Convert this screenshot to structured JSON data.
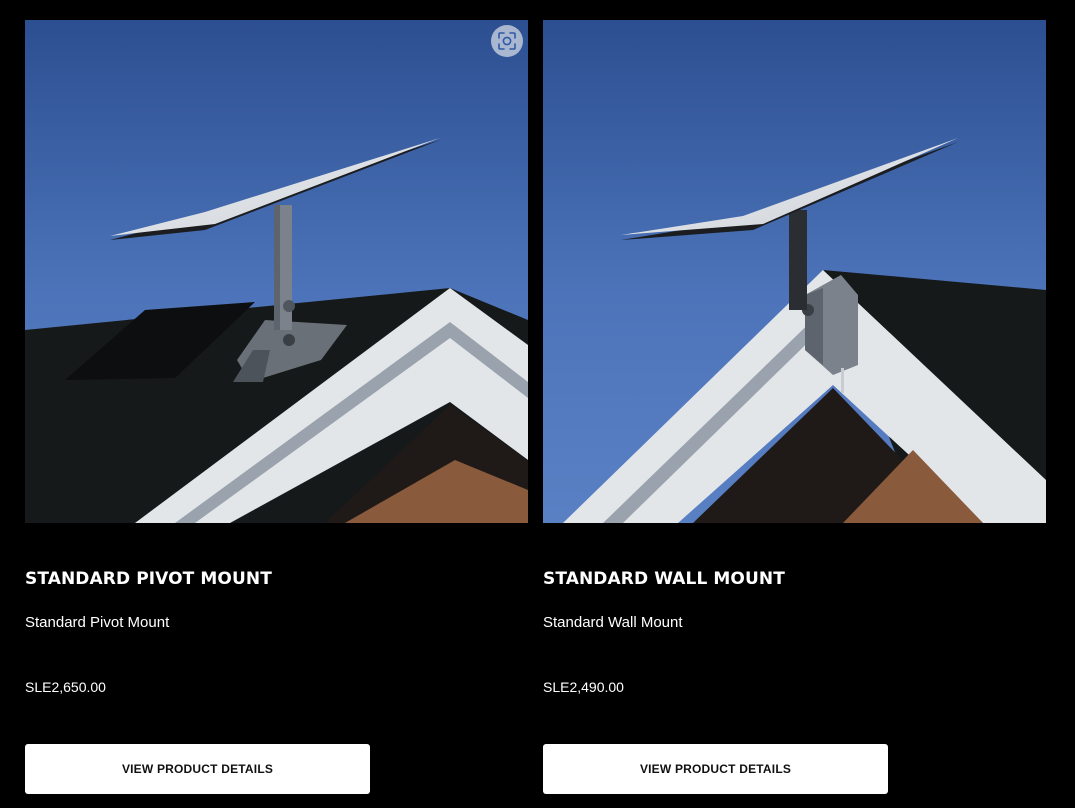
{
  "products": [
    {
      "title": "STANDARD PIVOT MOUNT",
      "subtitle": "Standard Pivot Mount",
      "price": "SLE2,650.00",
      "button_label": "VIEW PRODUCT DETAILS",
      "image_alt": "Starlink dish on a standard pivot mount on a roof"
    },
    {
      "title": "STANDARD WALL MOUNT",
      "subtitle": "Standard Wall Mount",
      "price": "SLE2,490.00",
      "button_label": "VIEW PRODUCT DETAILS",
      "image_alt": "Starlink dish on a standard wall mount at a roof gable"
    }
  ],
  "icons": {
    "zoom": "zoom-focus-icon"
  },
  "colors": {
    "background": "#000000",
    "button_background": "#ffffff",
    "button_text": "#111111",
    "sky": "#3d63a8"
  }
}
